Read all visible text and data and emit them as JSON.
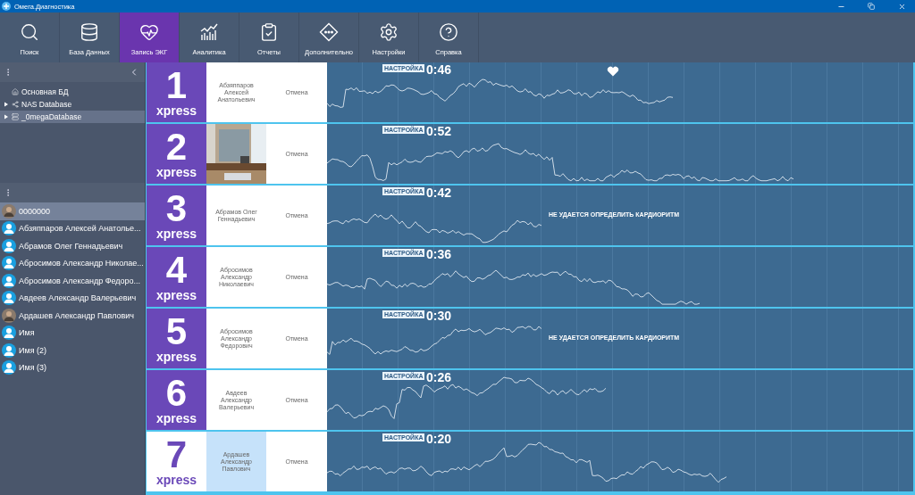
{
  "window": {
    "title": "Омега.Диагностика"
  },
  "toolbar": [
    {
      "label": "Поиск",
      "selected": false
    },
    {
      "label": "База Данных",
      "selected": false
    },
    {
      "label": "Запись ЭКГ",
      "selected": true
    },
    {
      "label": "Аналитика",
      "selected": false
    },
    {
      "label": "Отчеты",
      "selected": false
    },
    {
      "label": "Дополнительно",
      "selected": false
    },
    {
      "label": "Настройки",
      "selected": false
    },
    {
      "label": "Справка",
      "selected": false
    }
  ],
  "databases": [
    {
      "label": "Основная БД",
      "kind": "home",
      "collapsible": false,
      "selected": false
    },
    {
      "label": "NAS Database",
      "kind": "network",
      "collapsible": true,
      "selected": false
    },
    {
      "label": "_0megaDatabase",
      "kind": "server",
      "collapsible": true,
      "selected": true
    }
  ],
  "patients": [
    {
      "name": "0000000",
      "selected": true
    },
    {
      "name": "Абзяппаров Алексей Анатолье...",
      "kind": "default",
      "selected": false
    },
    {
      "name": "Абрамов Олег Геннадьевич",
      "kind": "default",
      "selected": false
    },
    {
      "name": "Абросимов Александр Николае...",
      "kind": "default",
      "selected": false
    },
    {
      "name": "Абросимов Александр Федоро...",
      "kind": "default",
      "selected": false
    },
    {
      "name": "Авдеев Александр Валерьевич",
      "kind": "default",
      "selected": false
    },
    {
      "name": "Ардашев Александр Павлович",
      "selected": false
    },
    {
      "name": "Имя",
      "kind": "default",
      "selected": false
    },
    {
      "name": "Имя (2)",
      "kind": "default",
      "selected": false
    },
    {
      "name": "Имя (3)",
      "kind": "default",
      "selected": false
    }
  ],
  "recordings": [
    {
      "number": "1",
      "brand": "xpress",
      "patient": {
        "kind": "name",
        "text": "Абзяппаров Алексей Анатольевич"
      },
      "cancel": "Отмена",
      "badge": "НАСТРОЙКА",
      "timer": "0:46",
      "heart": true,
      "selected": false
    },
    {
      "number": "2",
      "brand": "xpress",
      "cancel": "Отмена",
      "badge": "НАСТРОЙКА",
      "timer": "0:52",
      "heart": false,
      "selected": false
    },
    {
      "number": "3",
      "brand": "xpress",
      "patient": {
        "kind": "name",
        "text": "Абрамов Олег Геннадьевич"
      },
      "cancel": "Отмена",
      "badge": "НАСТРОЙКА",
      "timer": "0:42",
      "heart": false,
      "message": "НЕ УДАЕТСЯ ОПРЕДЕЛИТЬ КАРДИОРИТМ",
      "selected": false
    },
    {
      "number": "4",
      "brand": "xpress",
      "patient": {
        "kind": "name",
        "text": "Абросимов Александр Николаевич"
      },
      "cancel": "Отмена",
      "badge": "НАСТРОЙКА",
      "timer": "0:36",
      "heart": false,
      "selected": false
    },
    {
      "number": "5",
      "brand": "xpress",
      "patient": {
        "kind": "name",
        "text": "Абросимов Александр Федорович"
      },
      "cancel": "Отмена",
      "badge": "НАСТРОЙКА",
      "timer": "0:30",
      "heart": false,
      "message": "НЕ УДАЕТСЯ ОПРЕДЕЛИТЬ КАРДИОРИТМ",
      "selected": false
    },
    {
      "number": "6",
      "brand": "xpress",
      "patient": {
        "kind": "name",
        "text": "Авдеев Александр Валерьевич"
      },
      "cancel": "Отмена",
      "badge": "НАСТРОЙКА",
      "timer": "0:26",
      "heart": false,
      "selected": false
    },
    {
      "number": "7",
      "brand": "xpress",
      "patient": {
        "kind": "name",
        "text": "Ардашев Александр Павлович"
      },
      "cancel": "Отмена",
      "badge": "НАСТРОЙКА",
      "timer": "0:20",
      "heart": false,
      "selected": true
    }
  ]
}
